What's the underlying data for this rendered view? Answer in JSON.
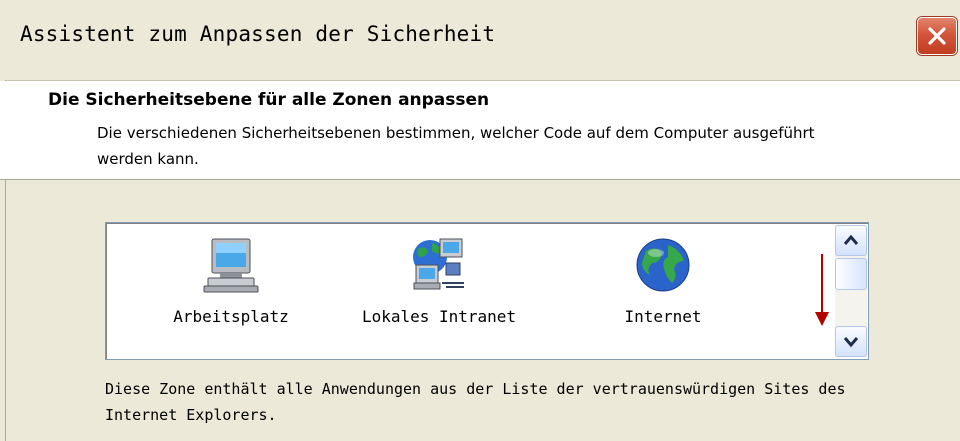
{
  "window": {
    "title": "Assistent zum Anpassen der Sicherheit"
  },
  "header": {
    "title": "Die Sicherheitsebene für alle Zonen anpassen",
    "description": "Die verschiedenen Sicherheitsebenen bestimmen, welcher Code auf dem Computer ausgeführt werden kann."
  },
  "zones": {
    "items": [
      {
        "label": "Arbeitsplatz",
        "icon": "computer-icon"
      },
      {
        "label": "Lokales Intranet",
        "icon": "network-icon"
      },
      {
        "label": "Internet",
        "icon": "globe-icon"
      }
    ]
  },
  "zone_description": "Diese Zone enthält alle Anwendungen aus der Liste der vertrauenswürdigen Sites des Internet Explorers.",
  "annotation": {
    "icon": "scroll-down-indicator-arrow",
    "color": "#b40000"
  },
  "colors": {
    "dialog_bg": "#ece9d8",
    "close_button": "#d2563b",
    "scroll_button": "#d4e2fb"
  }
}
